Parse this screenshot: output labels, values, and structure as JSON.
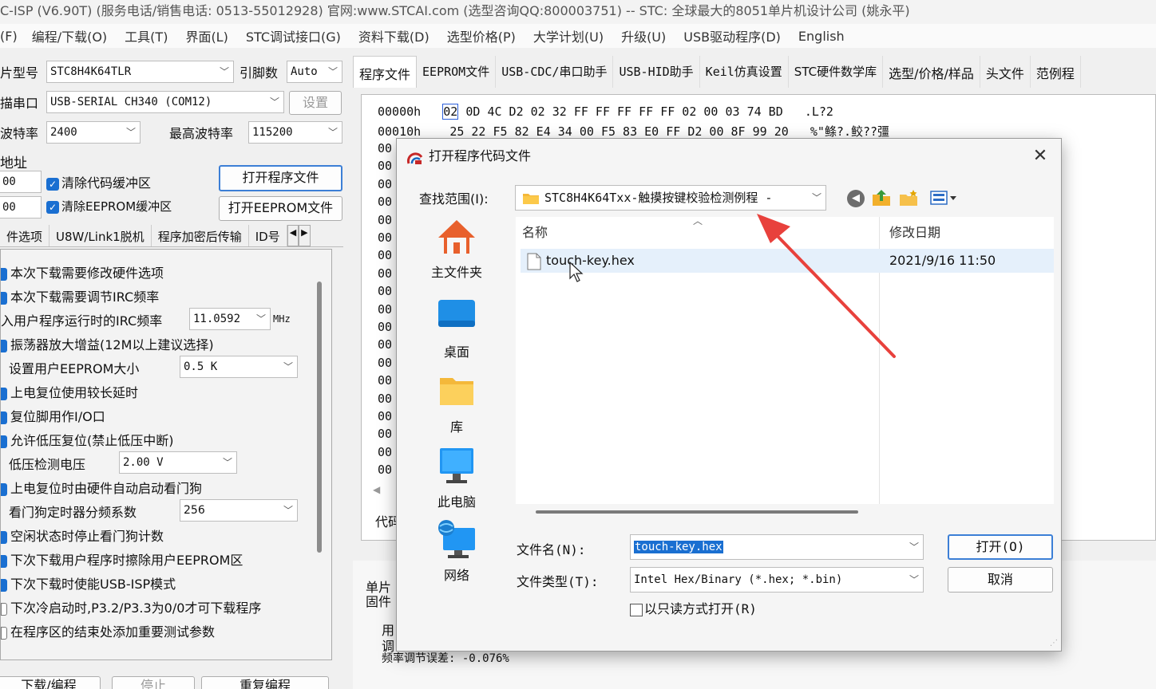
{
  "window_title": "C-ISP (V6.90T) (服务电话/销售电话: 0513-55012928) 官网:www.STCAI.com  (选型咨询QQ:800003751) -- STC: 全球最大的8051单片机设计公司 (姚永平)",
  "menu": [
    "(F)",
    "编程/下载(O)",
    "工具(T)",
    "界面(L)",
    "STC调试接口(G)",
    "资料下载(D)",
    "选型价格(P)",
    "大学计划(U)",
    "升级(U)",
    "USB驱动程序(D)",
    "English"
  ],
  "left": {
    "chip_label": "片型号",
    "chip_value": "STC8H4K64TLR",
    "pins_label": "引脚数",
    "pins_value": "Auto",
    "port_label": "描串口",
    "port_value": "USB-SERIAL CH340 (COM12)",
    "settings_btn": "设置",
    "baud_label": "波特率",
    "baud_value": "2400",
    "max_baud_label": "最高波特率",
    "max_baud_value": "115200",
    "addr_label": "地址",
    "addr1": "00",
    "addr2": "00",
    "clear_code": "清除代码缓冲区",
    "clear_eeprom": "清除EEPROM缓冲区",
    "open_prog_btn": "打开程序文件",
    "open_eeprom_btn": "打开EEPROM文件",
    "tabs": [
      "件选项",
      "U8W/Link1脱机",
      "程序加密后传输",
      "ID号"
    ],
    "options": [
      "本次下载需要修改硬件选项",
      "本次下载需要调节IRC频率",
      "入用户程序运行时的IRC频率",
      "振荡器放大增益(12M以上建议选择)",
      "设置用户EEPROM大小",
      "上电复位使用较长延时",
      "复位脚用作I/O口",
      "允许低压复位(禁止低压中断)",
      "低压检测电压",
      "上电复位时由硬件自动启动看门狗",
      "看门狗定时器分频系数",
      "空闲状态时停止看门狗计数",
      "下次下载用户程序时擦除用户EEPROM区",
      "下次下载时使能USB-ISP模式",
      "下次冷启动时,P3.2/P3.3为0/0才可下载程序",
      "在程序区的结束处添加重要测试参数"
    ],
    "irc_value": "11.0592",
    "irc_unit": "MHz",
    "eeprom_size": "0.5 K",
    "lvd_value": "2.00 V",
    "wdt_div": "256",
    "bottom_btns": [
      "下载/编程",
      "停止",
      "重复编程"
    ]
  },
  "right": {
    "tabs": [
      "程序文件",
      "EEPROM文件",
      "USB-CDC/串口助手",
      "USB-HID助手",
      "Keil仿真设置",
      "STC硬件数学库",
      "选型/价格/样品",
      "头文件",
      "范例程"
    ],
    "hex_lines": [
      {
        "addr": "00000h",
        "first": "02",
        "bytes": "0D 4C D2 02 32 FF FF FF FF FF 02 00 03 74 BD",
        "ascii": ".L?2"
      },
      {
        "addr": "00010h",
        "first": "",
        "bytes": "25 22 F5 82 E4 34 00 F5 83 E0 FF D2 00 8F 99 20",
        "ascii": "%\"鲦?.鲛??彊"
      }
    ],
    "addr_stub": "00",
    "code_label": "代码",
    "lower_lines": [
      "单片",
      "固件",
      "用",
      "调",
      "频率调节误差: -0.076%"
    ]
  },
  "dialog": {
    "title": "打开程序代码文件",
    "lookin_label": "查找范围(I):",
    "lookin_value": "STC8H4K64Txx-触摸按键校验检测例程 -",
    "places": [
      "主文件夹",
      "桌面",
      "库",
      "此电脑",
      "网络"
    ],
    "col_name": "名称",
    "col_date": "修改日期",
    "file_name": "touch-key.hex",
    "file_date": "2021/9/16 11:50",
    "filename_label": "文件名(N):",
    "filename_value": "touch-key.hex",
    "filetype_label": "文件类型(T):",
    "filetype_value": "Intel Hex/Binary (*.hex; *.bin)",
    "readonly_label": "以只读方式打开(R)",
    "open_btn": "打开(O)",
    "cancel_btn": "取消"
  },
  "colors": {
    "accent": "#1a6fd1",
    "annotation_arrow": "#e8413c"
  }
}
